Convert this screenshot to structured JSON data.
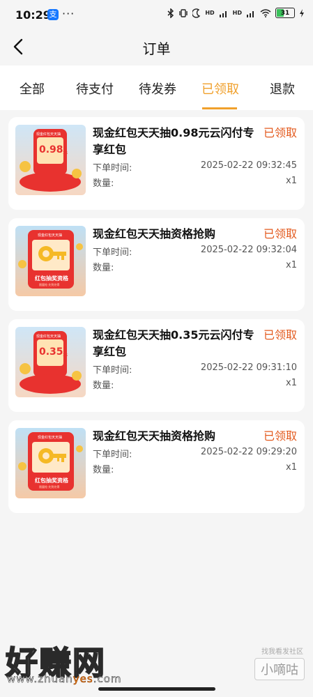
{
  "status_bar": {
    "time": "10:29",
    "alipay_badge": "支",
    "more": "···",
    "network": "HD",
    "battery": "31"
  },
  "header": {
    "title": "订单",
    "back_icon": "chevron-left-icon"
  },
  "tabs": [
    {
      "label": "全部",
      "active": false
    },
    {
      "label": "待支付",
      "active": false
    },
    {
      "label": "待发券",
      "active": false
    },
    {
      "label": "已领取",
      "active": true
    },
    {
      "label": "退款",
      "active": false
    }
  ],
  "orders": [
    {
      "title": "现金红包天天抽0.98元云闪付专享红包",
      "status": "已领取",
      "time_label": "下单时间:",
      "time": "2025-02-22 09:32:45",
      "qty_label": "数量:",
      "qty": "x1",
      "thumb": {
        "kind": "redpacket",
        "amount": "0.98",
        "unit": "元",
        "caption": "现金红包天天抽"
      }
    },
    {
      "title": "现金红包天天抽资格抢购",
      "status": "已领取",
      "time_label": "下单时间:",
      "time": "2025-02-22 09:32:04",
      "qty_label": "数量:",
      "qty": "x1",
      "thumb": {
        "kind": "key",
        "banner": "红包抽奖资格",
        "caption": "现金红包天天抽",
        "sub": "限量抢 先到先得"
      }
    },
    {
      "title": "现金红包天天抽0.35元云闪付专享红包",
      "status": "已领取",
      "time_label": "下单时间:",
      "time": "2025-02-22 09:31:10",
      "qty_label": "数量:",
      "qty": "x1",
      "thumb": {
        "kind": "redpacket",
        "amount": "0.35",
        "unit": "元",
        "caption": "现金红包天天抽"
      }
    },
    {
      "title": "现金红包天天抽资格抢购",
      "status": "已领取",
      "time_label": "下单时间:",
      "time": "2025-02-22 09:29:20",
      "qty_label": "数量:",
      "qty": "x1",
      "thumb": {
        "kind": "key",
        "banner": "红包抽奖资格",
        "caption": "现金红包天天抽",
        "sub": "限量抢 先到先得"
      }
    }
  ],
  "watermark": {
    "site": "好赚网",
    "url_a": "www.zhuan",
    "url_b": "yes",
    "url_c": ".com",
    "small_top": "找我看发社区",
    "small_badge": "小嘀咕"
  },
  "colors": {
    "accent": "#f0a02c",
    "status": "#e35a1e",
    "background": "#f5f5f5"
  }
}
